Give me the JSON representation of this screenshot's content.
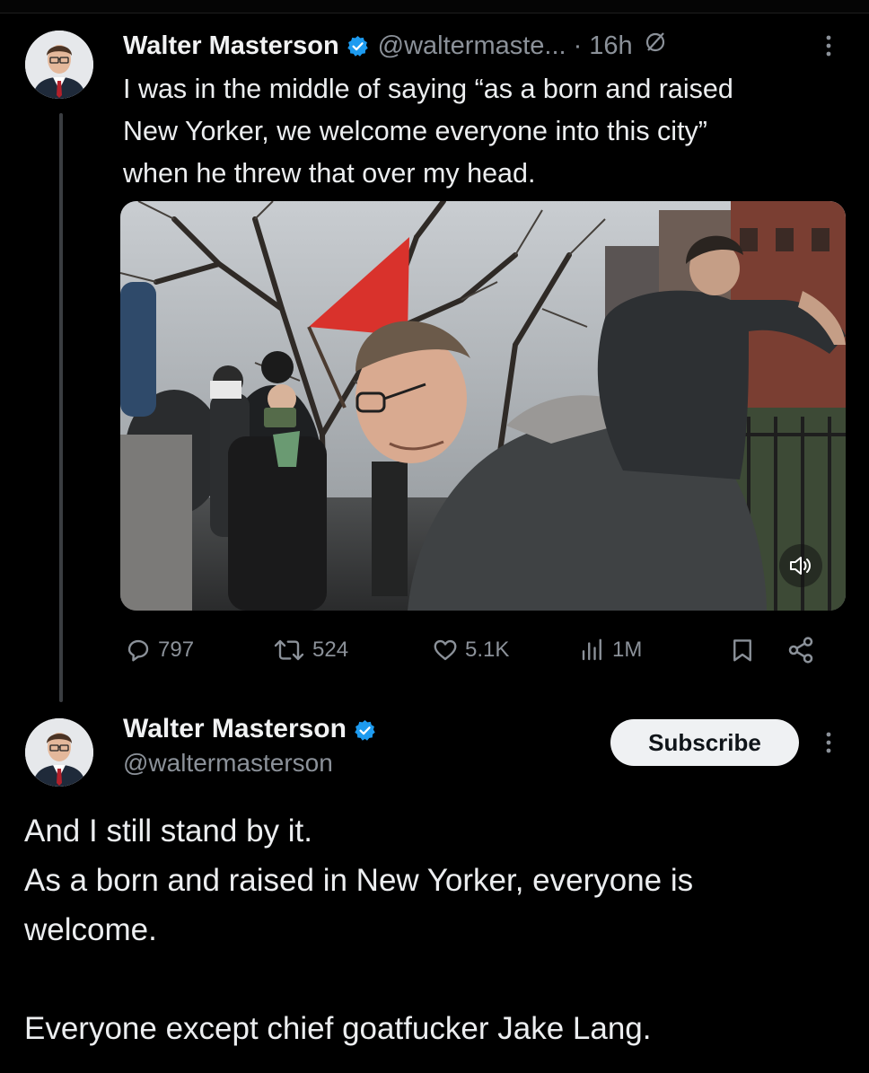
{
  "tweet1": {
    "author_name": "Walter Masterson",
    "handle": "@waltermaste...",
    "separator": "·",
    "time": "16h",
    "text_lines": [
      "I was in the middle of saying “as a born and raised",
      "New Yorker, we welcome everyone into this city”",
      "when he threw that over my head."
    ],
    "actions": {
      "replies": "797",
      "reposts": "524",
      "likes": "5.1K",
      "views": "1M"
    }
  },
  "tweet2": {
    "author_name": "Walter Masterson",
    "handle": "@waltermasterson",
    "subscribe_label": "Subscribe",
    "body_lines": [
      "And I still stand by it.",
      "As a born and raised in New Yorker, everyone is",
      "welcome."
    ],
    "body_last_line": "Everyone except chief goatfucker Jake Lang."
  },
  "colors": {
    "background": "#000000",
    "text": "#e7e9ea",
    "muted": "#8b9199",
    "verified_blue": "#1d9bf0"
  }
}
